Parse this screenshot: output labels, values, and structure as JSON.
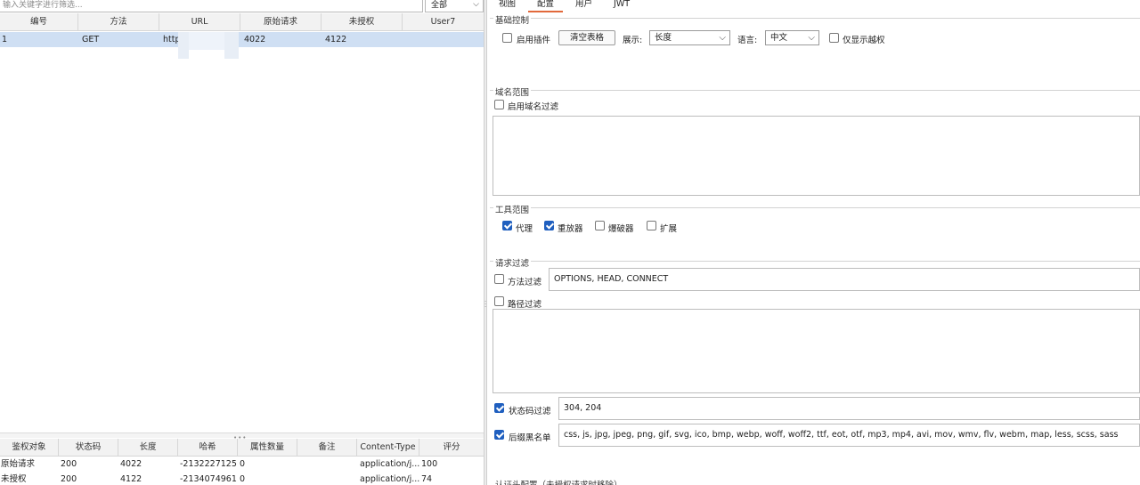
{
  "left": {
    "filter_placeholder": "输入关键字进行筛选...",
    "scope_value": "全部",
    "columns": [
      "编号",
      "方法",
      "URL",
      "原始请求",
      "未授权",
      "User7"
    ],
    "row": {
      "id": "1",
      "method": "GET",
      "url": "http",
      "original": "4022",
      "unauth": "4122",
      "user7": ""
    },
    "detail_columns": [
      "鉴权对象",
      "状态码",
      "长度",
      "哈希",
      "属性数量",
      "备注",
      "Content-Type",
      "评分"
    ],
    "detail_rows": [
      {
        "target": "原始请求",
        "status": "200",
        "length": "4022",
        "hash": "-2132227125",
        "attrs": "0",
        "note": "",
        "content_type": "application/j...",
        "score": "100"
      },
      {
        "target": "未授权",
        "status": "200",
        "length": "4122",
        "hash": "-2134074961",
        "attrs": "0",
        "note": "",
        "content_type": "application/j...",
        "score": "74"
      }
    ]
  },
  "right": {
    "tabs": [
      "视图",
      "配置",
      "用户",
      "JWT"
    ],
    "active_tab": "配置",
    "basic": {
      "title": "基础控制",
      "enable_plugin": "启用插件",
      "clear_table": "清空表格",
      "display_label": "展示:",
      "display_value": "长度",
      "language_label": "语言:",
      "language_value": "中文",
      "show_only_unauth": "仅显示越权"
    },
    "domain": {
      "title": "域名范围",
      "enable_filter": "启用域名过滤"
    },
    "tools": {
      "title": "工具范围",
      "proxy": "代理",
      "repeater": "重放器",
      "intruder": "爆破器",
      "extension": "扩展"
    },
    "request_filter": {
      "title": "请求过滤",
      "method_filter": "方法过滤",
      "method_value": "OPTIONS, HEAD, CONNECT",
      "path_filter": "路径过滤",
      "status_filter": "状态码过滤",
      "status_value": "304, 204",
      "suffix_blacklist": "后缀黑名单",
      "suffix_value": "css, js, jpg, jpeg, png, gif, svg, ico, bmp, webp, woff, woff2, ttf, eot, otf, mp3, mp4, avi, mov, wmv, flv, webm, map, less, scss, sass"
    },
    "auth_header": {
      "title": "认证头配置（未授权请求时移除）"
    }
  },
  "colors": {
    "selected_row": "#cfdff3",
    "accent_tab": "#e2693b",
    "checkbox_checked": "#1f5fbf"
  }
}
